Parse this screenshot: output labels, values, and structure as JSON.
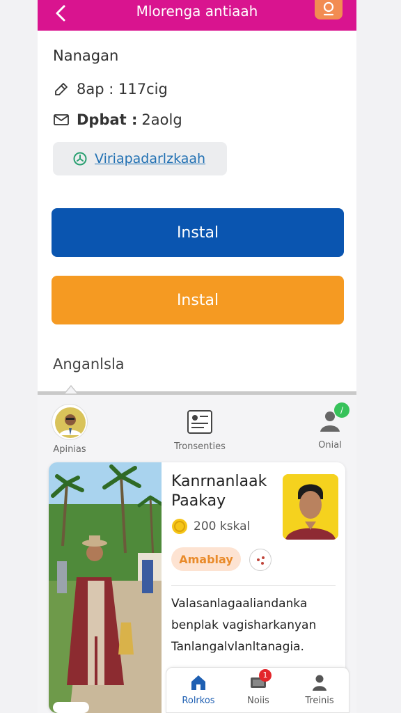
{
  "header": {
    "title": "Mlorenga antiaah"
  },
  "details": {
    "section_title": "Nanagan",
    "row1_value": "8ap : 117cig",
    "row2_label": "Dpbat :",
    "row2_value": "2aolg",
    "link_text": "Viriapadarlzkaah"
  },
  "buttons": {
    "primary_label": "Instal",
    "secondary_label": "Instal"
  },
  "lower": {
    "section_title": "Anganlsla",
    "tabs": [
      {
        "label": "Apinias"
      },
      {
        "label": "Tronsenties"
      },
      {
        "label": "Onial"
      }
    ],
    "card": {
      "name": "Kanrnanlaak Paakay",
      "points": "200 kskal",
      "badge": "Amablay",
      "description": "Valasanlagaaliandanka benplak vagisharkanyan Tanlangalvlanltanagia."
    }
  },
  "bottom_nav": {
    "items": [
      {
        "label": "Rolrkos"
      },
      {
        "label": "Noiis",
        "badge": "1"
      },
      {
        "label": "Treinis"
      }
    ]
  },
  "colors": {
    "header": "#d9148f",
    "primary": "#0a55b0",
    "secondary": "#f59a22",
    "link": "#1f6fb2"
  }
}
